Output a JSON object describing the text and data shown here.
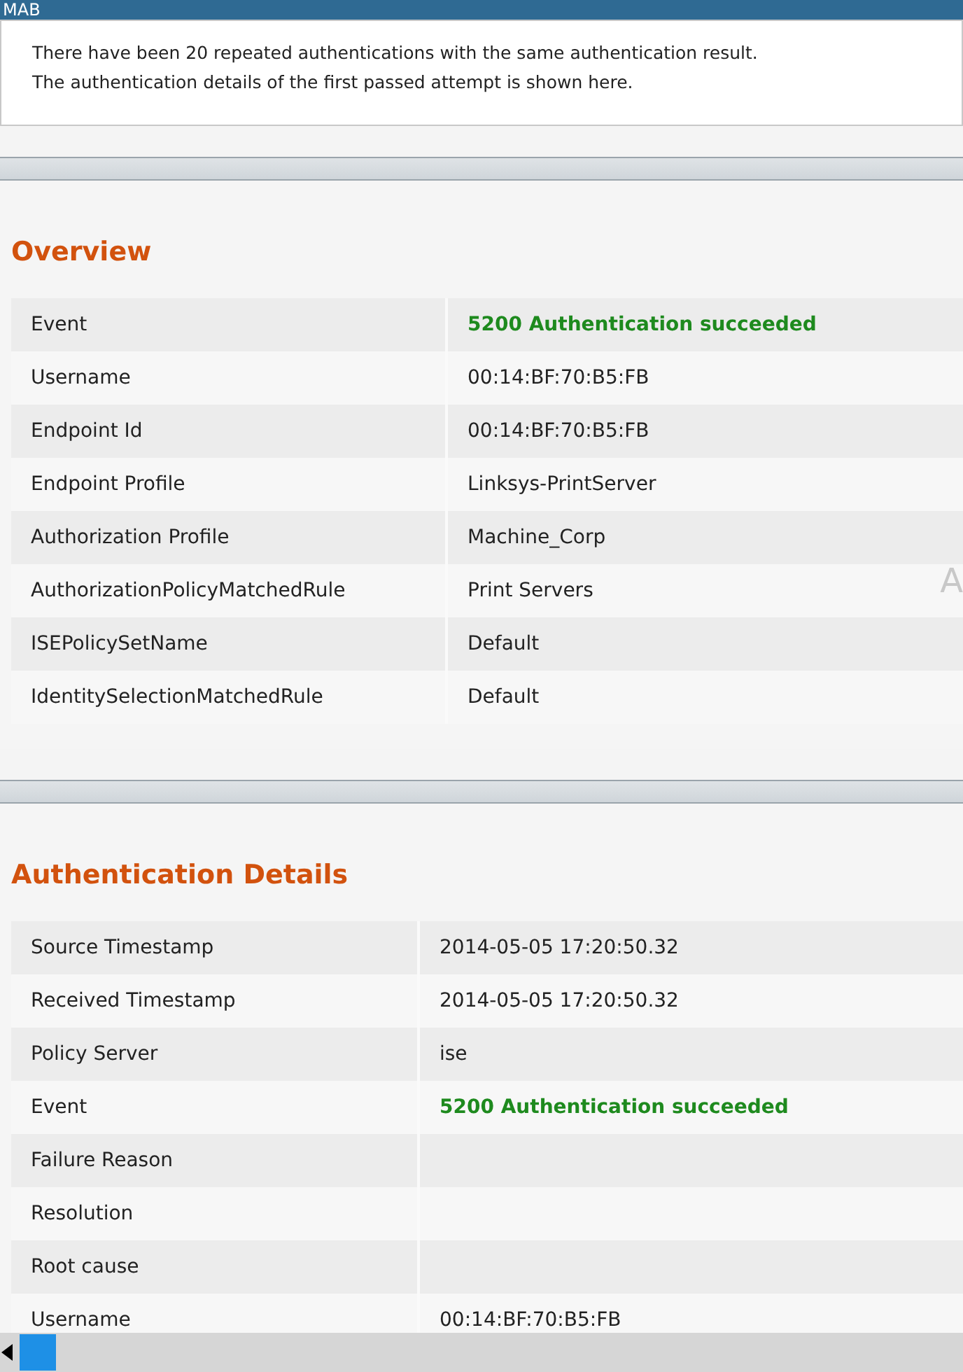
{
  "header": {
    "title": "MAB"
  },
  "notice": {
    "lines": [
      "There have been 20 repeated authentications with the same authentication result.",
      "The authentication details of the first passed attempt is shown here."
    ]
  },
  "sections": [
    {
      "title": "Overview",
      "edge_text": "A",
      "rows": [
        {
          "label": "Event",
          "value": "5200 Authentication succeeded",
          "kind": "success"
        },
        {
          "label": "Username",
          "value": "00:14:BF:70:B5:FB"
        },
        {
          "label": "Endpoint Id",
          "value": "00:14:BF:70:B5:FB"
        },
        {
          "label": "Endpoint Profile",
          "value": "Linksys-PrintServer"
        },
        {
          "label": "Authorization Profile",
          "value": "Machine_Corp"
        },
        {
          "label": "AuthorizationPolicyMatchedRule",
          "value": "Print Servers"
        },
        {
          "label": "ISEPolicySetName",
          "value": "Default"
        },
        {
          "label": "IdentitySelectionMatchedRule",
          "value": "Default"
        }
      ]
    },
    {
      "title": "Authentication Details",
      "rows": [
        {
          "label": "Source Timestamp",
          "value": "2014-05-05 17:20:50.32"
        },
        {
          "label": "Received Timestamp",
          "value": "2014-05-05 17:20:50.32"
        },
        {
          "label": "Policy Server",
          "value": "ise"
        },
        {
          "label": "Event",
          "value": "5200 Authentication succeeded",
          "kind": "success"
        },
        {
          "label": "Failure Reason"
        },
        {
          "label": "Resolution"
        },
        {
          "label": "Root cause"
        },
        {
          "label": "Username",
          "value": "00:14:BF:70:B5:FB"
        }
      ]
    }
  ]
}
